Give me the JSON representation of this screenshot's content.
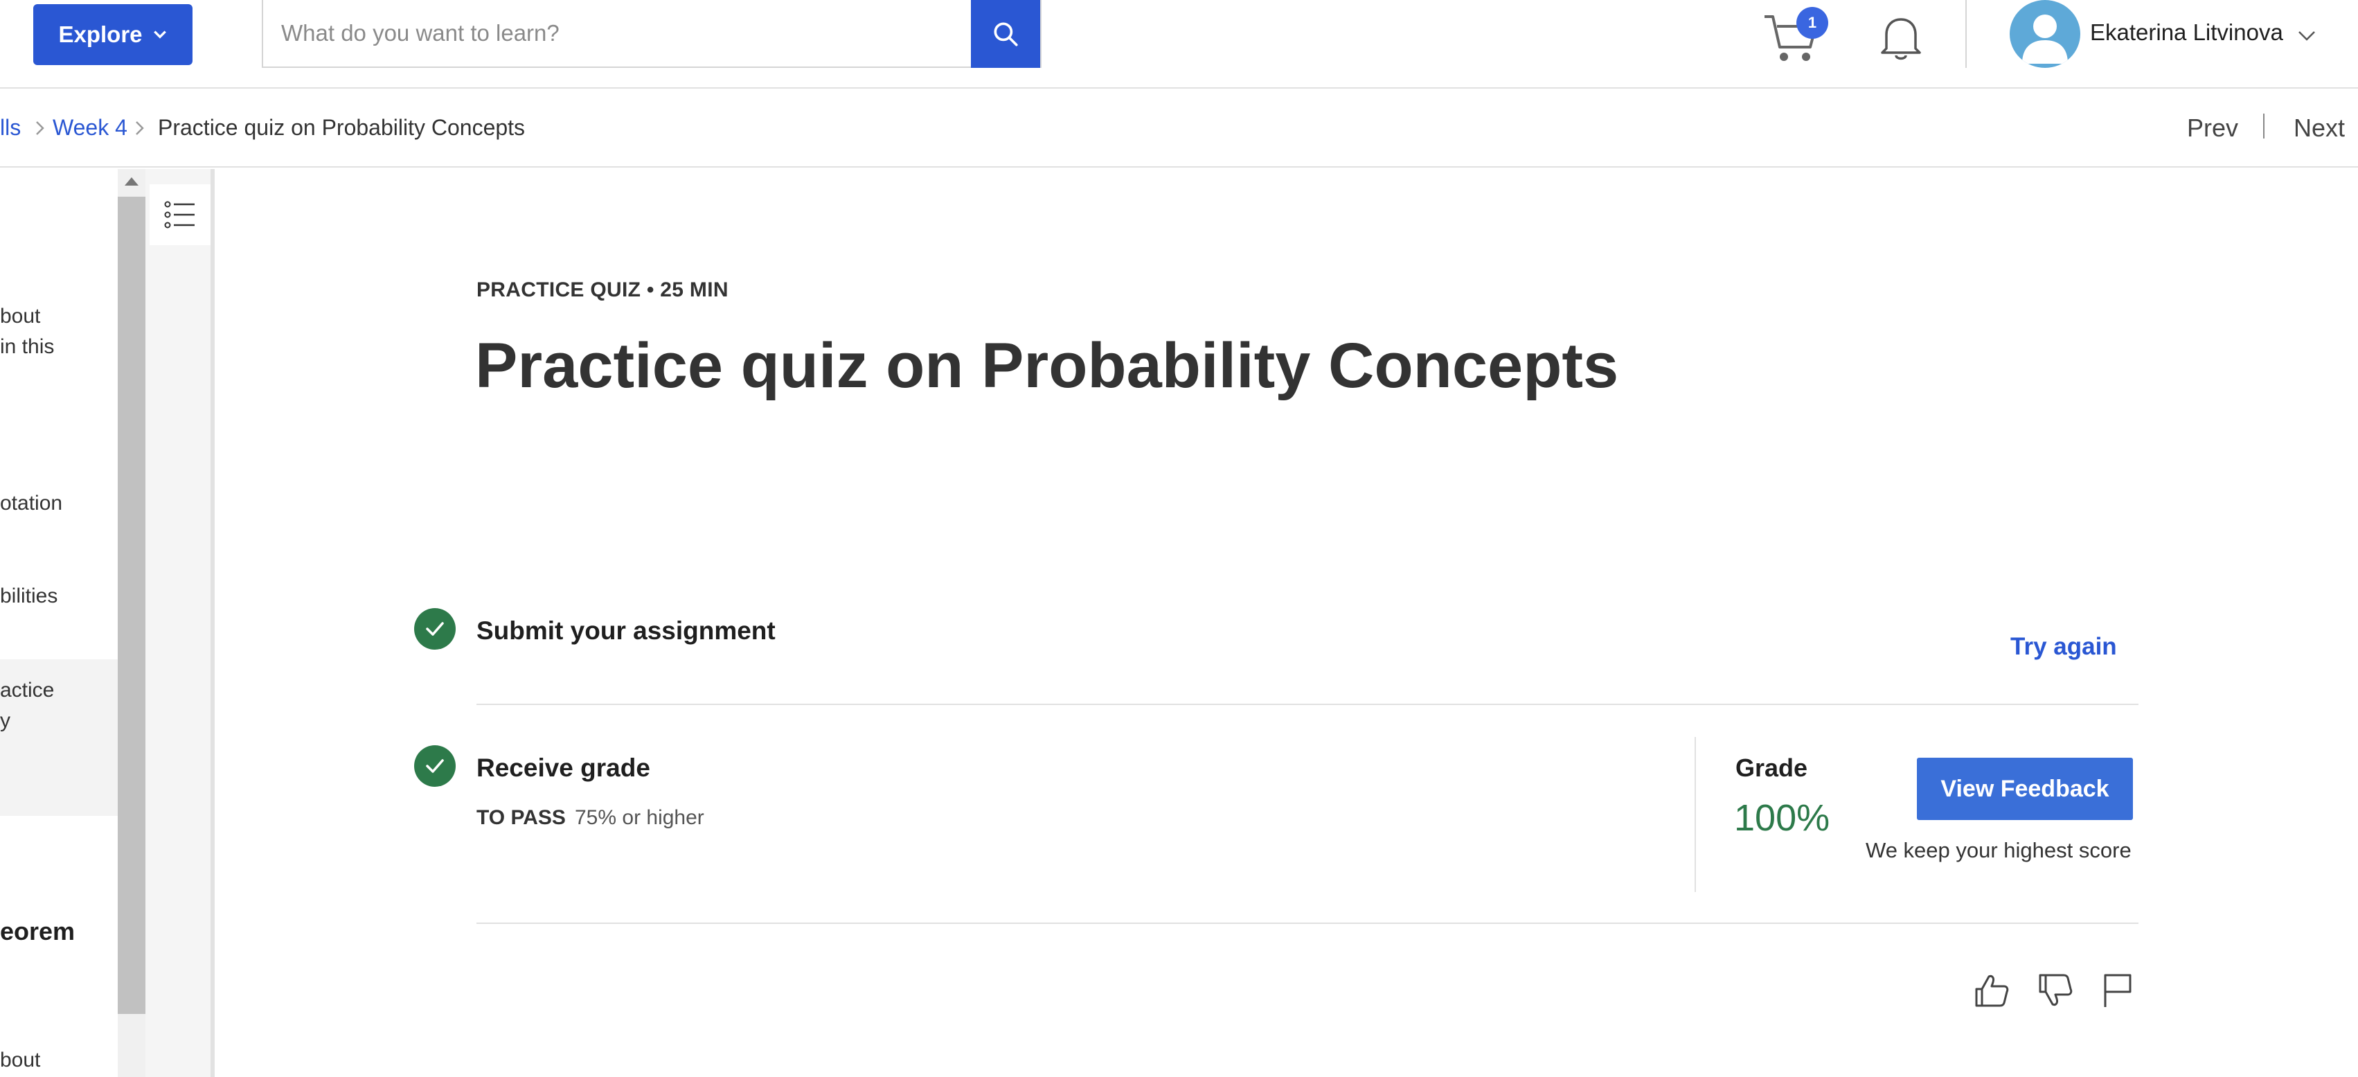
{
  "header": {
    "explore_label": "Explore",
    "search_placeholder": "What do you want to learn?",
    "cart_count": "1",
    "user_name": "Ekaterina Litvinova",
    "icons": [
      "chevron-down-icon",
      "search-icon",
      "cart-icon",
      "bell-icon",
      "user-avatar-icon"
    ]
  },
  "breadcrumb": {
    "items": [
      {
        "label": "lls",
        "link": true
      },
      {
        "label": "Week 4",
        "link": true
      },
      {
        "label": "Practice quiz on Probability Concepts",
        "link": false
      }
    ],
    "prev_label": "Prev",
    "next_label": "Next"
  },
  "sidebar": {
    "fragments": [
      "bout",
      "in this",
      "otation",
      "bilities",
      "actice",
      "y",
      "eorem",
      "bout"
    ]
  },
  "quiz": {
    "kicker": "PRACTICE QUIZ • 25 MIN",
    "title": "Practice quiz on Probability Concepts",
    "steps": {
      "submit_title": "Submit your assignment",
      "try_again_label": "Try again",
      "grade_title": "Receive grade",
      "to_pass_label": "TO PASS",
      "to_pass_value": "75% or higher"
    },
    "grade": {
      "label": "Grade",
      "value": "100%",
      "view_feedback_label": "View Feedback",
      "keep_note": "We keep your highest score"
    }
  },
  "colors": {
    "brand_blue": "#2a57d3",
    "success_green": "#2d7a4a"
  }
}
